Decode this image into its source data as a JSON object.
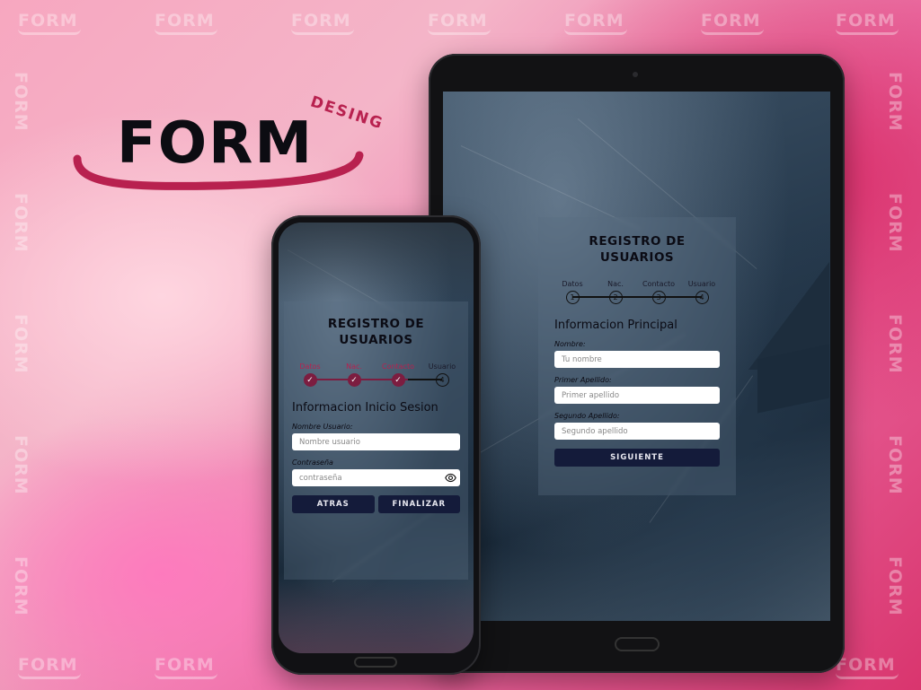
{
  "brand": {
    "title": "FORM",
    "subtitle": "DESING",
    "accent": "#b8214f",
    "watermark": "FORM"
  },
  "tablet_form": {
    "title": "REGISTRO DE USUARIOS",
    "steps": [
      {
        "label": "Datos",
        "number": "1"
      },
      {
        "label": "Nac.",
        "number": "2"
      },
      {
        "label": "Contacto",
        "number": "3"
      },
      {
        "label": "Usuario",
        "number": "4"
      }
    ],
    "section": "Informacion Principal",
    "fields": [
      {
        "label": "Nombre:",
        "placeholder": "Tu nombre"
      },
      {
        "label": "Primer Apellido:",
        "placeholder": "Primer apellido"
      },
      {
        "label": "Segundo Apellido:",
        "placeholder": "Segundo apellido"
      }
    ],
    "next_button": "SIGUIENTE"
  },
  "phone_form": {
    "title": "REGISTRO DE USUARIOS",
    "steps": [
      {
        "label": "Datos",
        "state": "done"
      },
      {
        "label": "Nac.",
        "state": "done"
      },
      {
        "label": "Contacto",
        "state": "done"
      },
      {
        "label": "Usuario",
        "number": "4",
        "state": "current"
      }
    ],
    "check_glyph": "✓",
    "section": "Informacion Inicio Sesion",
    "fields": [
      {
        "label": "Nombre Usuario:",
        "placeholder": "Nombre usuario"
      },
      {
        "label": "Contraseña",
        "placeholder": "contraseña"
      }
    ],
    "back_button": "ATRAS",
    "finish_button": "FINALIZAR"
  },
  "colors": {
    "button_bg": "#141b3a",
    "step_done": "#7c1d40"
  }
}
